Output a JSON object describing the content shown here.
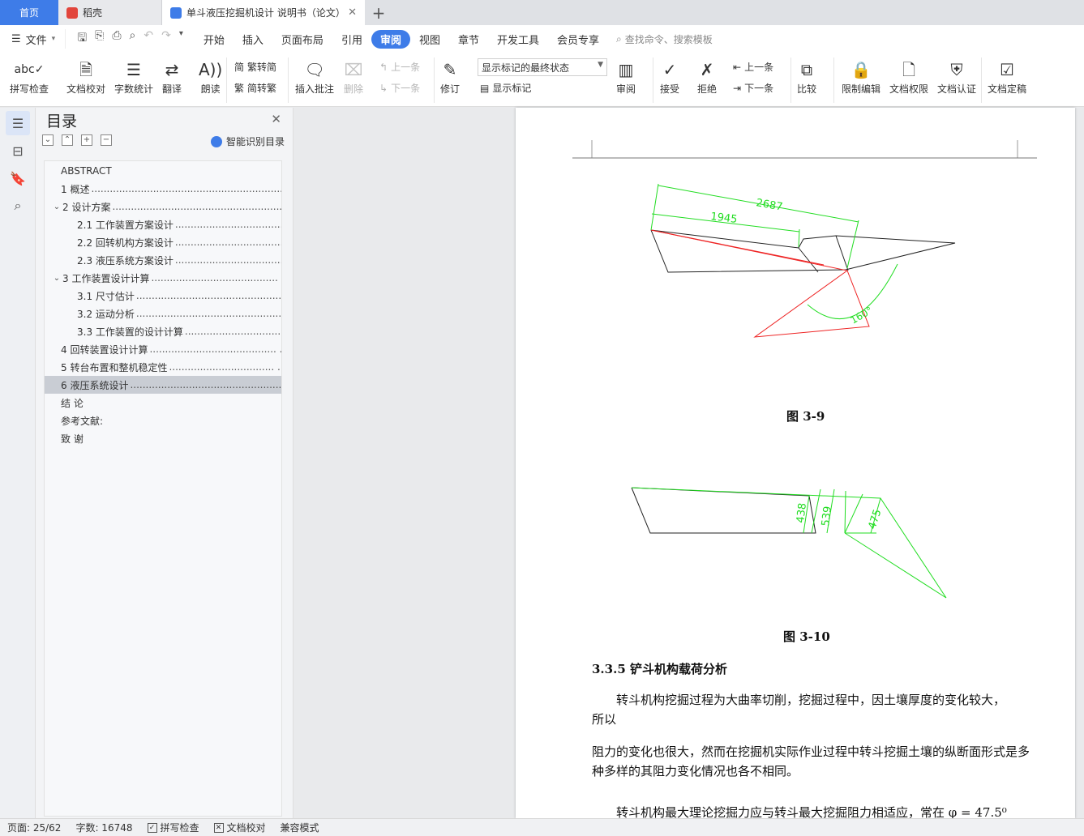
{
  "tabs": {
    "home": "首页",
    "docker": "稻壳",
    "document": "单斗液压挖掘机设计 说明书（论文）",
    "add_symbol": "+"
  },
  "menubar": {
    "file": "文件",
    "items": [
      "开始",
      "插入",
      "页面布局",
      "引用",
      "审阅",
      "视图",
      "章节",
      "开发工具",
      "会员专享"
    ],
    "active": "审阅",
    "search_placeholder": "查找命令、搜索模板"
  },
  "ribbon": {
    "spell_check": "拼写检查",
    "doc_proof": "文档校对",
    "word_count": "字数统计",
    "translate": "翻译",
    "read_aloud": "朗读",
    "trad_simp": "繁转简",
    "simp_trad": "简转繁",
    "insert_comment": "插入批注",
    "delete": "删除",
    "prev": "上一条",
    "next": "下一条",
    "revise": "修订",
    "markup_state": "显示标记的最终状态",
    "show_markup": "显示标记",
    "review": "审阅",
    "accept": "接受",
    "reject": "拒绝",
    "prev2": "上一条",
    "next2": "下一条",
    "compare": "比较",
    "restrict_edit": "限制编辑",
    "doc_permission": "文档权限",
    "doc_certify": "文档认证",
    "doc_finalize": "文档定稿"
  },
  "toc": {
    "title": "目录",
    "smart": "智能识别目录",
    "items": [
      {
        "label": "ABSTRACT",
        "dots": "",
        "indent": 0,
        "toggle": ""
      },
      {
        "label": "1  概述",
        "dots": "..................................................................  ...",
        "indent": 0,
        "toggle": ""
      },
      {
        "label": "2  设计方案",
        "dots": "...........................................................  ...",
        "indent": 0,
        "toggle": "v"
      },
      {
        "label": "2.1  工作装置方案设计",
        "dots": "...................................  ...",
        "indent": 1,
        "toggle": ""
      },
      {
        "label": "2.2  回转机构方案设计",
        "dots": "...................................  ...",
        "indent": 1,
        "toggle": ""
      },
      {
        "label": "2.3  液压系统方案设计",
        "dots": "...................................  ...",
        "indent": 1,
        "toggle": ""
      },
      {
        "label": "3  工作装置设计计算",
        "dots": ".........................................  ...",
        "indent": 0,
        "toggle": "v"
      },
      {
        "label": "3.1  尺寸估计",
        "dots": ".................................................  ...",
        "indent": 1,
        "toggle": ""
      },
      {
        "label": "3.2  运动分析",
        "dots": ".................................................  ...",
        "indent": 1,
        "toggle": ""
      },
      {
        "label": "3.3  工作装置的设计计算",
        "dots": "...............................  ...",
        "indent": 1,
        "toggle": ""
      },
      {
        "label": "4  回转装置设计计算",
        "dots": ".........................................  ...",
        "indent": 0,
        "toggle": ""
      },
      {
        "label": "5  转台布置和整机稳定性",
        "dots": "..................................  ...",
        "indent": 0,
        "toggle": ""
      },
      {
        "label": "6  液压系统设计",
        "dots": "...................................................  ...",
        "indent": 0,
        "toggle": ""
      },
      {
        "label": "结      论",
        "dots": "",
        "indent": 0,
        "toggle": ""
      },
      {
        "label": "参考文献:",
        "dots": "",
        "indent": 0,
        "toggle": ""
      },
      {
        "label": "  致    谢",
        "dots": "",
        "indent": 0,
        "toggle": ""
      }
    ],
    "selected_index": 12
  },
  "document": {
    "fig1": {
      "caption": "图 3-9",
      "dim_long": "2687",
      "dim_short": "1945",
      "angle": "160°"
    },
    "fig2": {
      "caption": "图 3-10",
      "dim_a": "438",
      "dim_b": "539",
      "dim_c": "475"
    },
    "heading": "3.3.5  铲斗机构载荷分析",
    "para1_line1": "转斗机构挖掘过程为大曲率切削，挖掘过程中，因土壤厚度的变化较大，",
    "para1_line2": "所以",
    "para2": "阻力的变化也很大，然而在挖掘机实际作业过程中转斗挖掘土壤的纵断面形式是多种多样的其阻力变化情况也各不相同。",
    "para3": "转斗机构最大理论挖掘力应与转斗最大挖掘阻力相适应，常在 φ = 47.5⁰"
  },
  "status": {
    "page": "页面: 25/62",
    "words": "字数: 16748",
    "spell": "拼写检查",
    "proof": "文档校对",
    "compat": "兼容模式"
  },
  "colors": {
    "accent": "#3e7ce8",
    "drawing_green": "#22dd22",
    "drawing_red": "#ee2222"
  }
}
